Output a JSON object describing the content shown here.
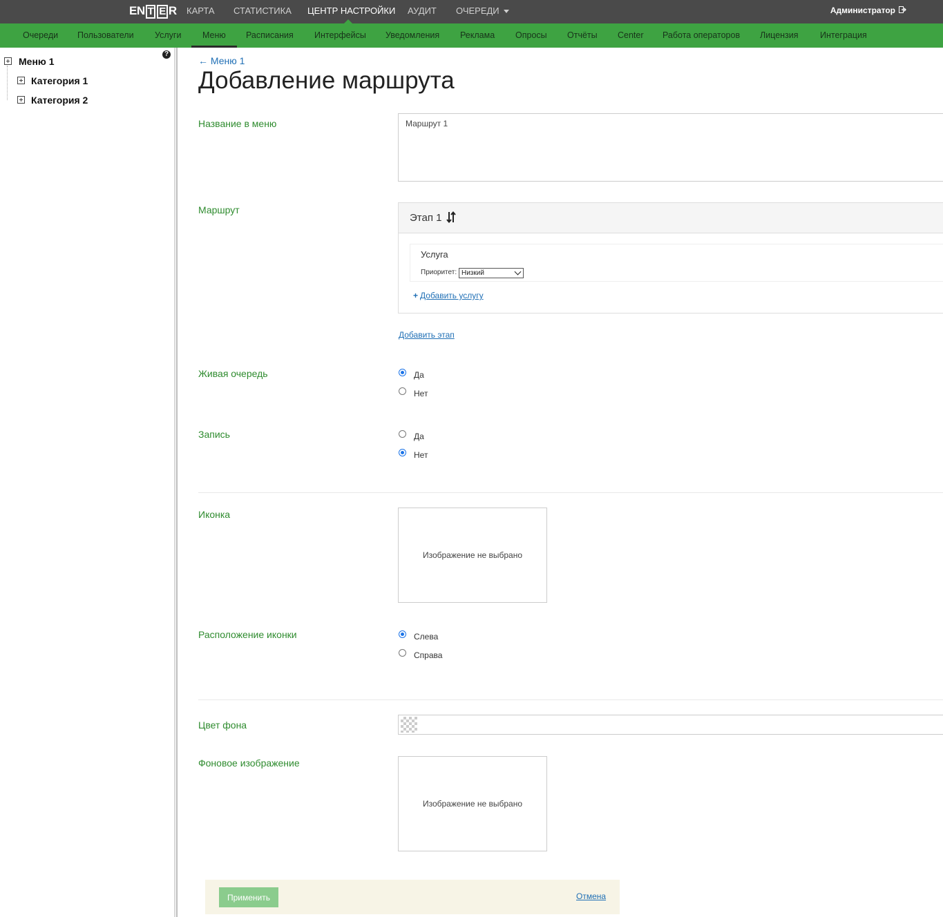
{
  "topbar": {
    "logo": {
      "pre": "EN",
      "box1": "T",
      "box2": "E",
      "post": "R"
    },
    "nav": [
      "КАРТА",
      "СТАТИСТИКА",
      "ЦЕНТР НАСТРОЙКИ",
      "АУДИТ",
      "ОЧЕРЕДИ"
    ],
    "active": "ЦЕНТР НАСТРОЙКИ",
    "user": "Администратор"
  },
  "subnav": {
    "items": [
      "Очереди",
      "Пользователи",
      "Услуги",
      "Меню",
      "Расписания",
      "Интерфейсы",
      "Уведомления",
      "Реклама",
      "Опросы",
      "Отчёты",
      "Center",
      "Работа операторов",
      "Лицензия",
      "Интеграция"
    ],
    "active": "Меню"
  },
  "tree": {
    "root": "Меню 1",
    "children": [
      "Категория 1",
      "Категория 2"
    ]
  },
  "page": {
    "back_link": "← Меню 1",
    "title": "Добавление маршрута"
  },
  "form": {
    "menu_name": {
      "label": "Название в меню",
      "value": "Маршрут 1"
    },
    "route": {
      "label": "Маршрут",
      "stage_title": "Этап 1",
      "service_title": "Услуга",
      "priority_label": "Приоритет:",
      "priority_value": "Низкий",
      "add_service": "Добавить услугу",
      "add_stage": "Добавить этап"
    },
    "live_queue": {
      "label": "Живая очередь",
      "options": [
        "Да",
        "Нет"
      ],
      "selected": "Да"
    },
    "booking": {
      "label": "Запись",
      "options": [
        "Да",
        "Нет"
      ],
      "selected": "Нет"
    },
    "icon": {
      "label": "Иконка",
      "placeholder": "Изображение не выбрано"
    },
    "icon_position": {
      "label": "Расположение иконки",
      "options": [
        "Слева",
        "Справа"
      ],
      "selected": "Слева"
    },
    "bg_color": {
      "label": "Цвет фона"
    },
    "bg_image": {
      "label": "Фоновое изображение",
      "placeholder": "Изображение не выбрано"
    }
  },
  "footer": {
    "apply": "Применить",
    "cancel": "Отмена"
  },
  "colors": {
    "topbar": "#4a4a4a",
    "subnav": "#3ea342",
    "label": "#2e8b2e",
    "link": "#1f6fb5",
    "radio_on": "#1a73e8"
  },
  "icons": [
    "plus-square-icon",
    "help-icon",
    "sort-icon",
    "logout-icon",
    "chevron-down-icon",
    "plus-icon"
  ]
}
